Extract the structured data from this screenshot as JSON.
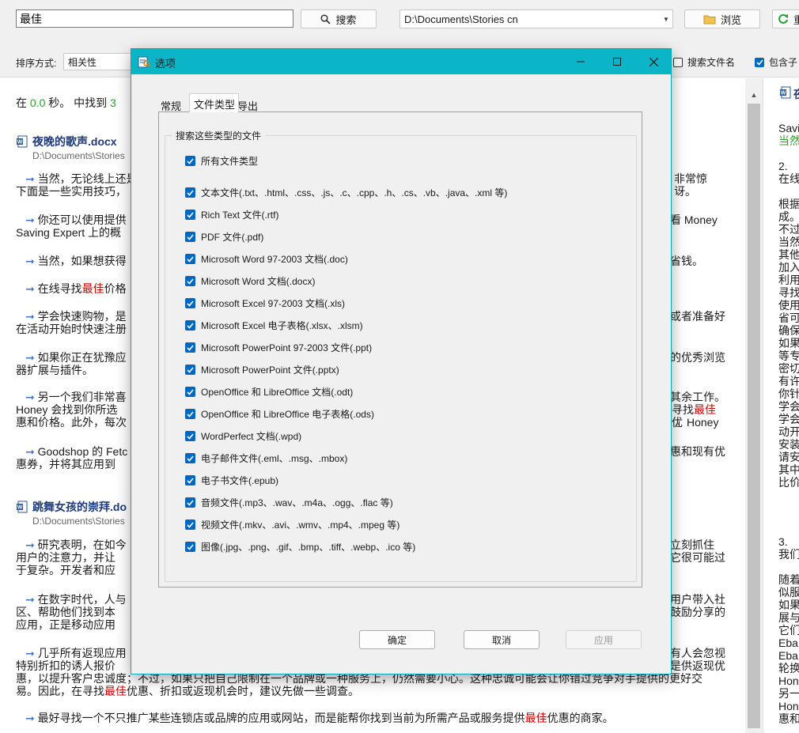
{
  "toolbar": {
    "search_value": "最佳",
    "search_button": "搜索",
    "path": "D:\\Documents\\Stories cn",
    "browse_button": "浏览",
    "refresh_button": "重"
  },
  "sortbar": {
    "label": "排序方式:",
    "sort_value": "相关性",
    "search_filenames": "搜索文件名",
    "include_sub": "包含子"
  },
  "results": {
    "status_prefix": "在",
    "time": "0.0",
    "status_mid": "秒。 中找到",
    "count": "3",
    "doc1": {
      "title": "夜晚的歌声.docx",
      "path": "D:\\Documents\\Stories",
      "p1a": "当然，无论线上还是",
      "p1b": "非常惊讶。",
      "p1c": "下面是一些实用技巧，",
      "p2a": "你还可以使用提供",
      "p2b": "看 Money",
      "p2c": "Saving Expert 上的概",
      "p3a": "当然，如果想获得",
      "p3b": "省钱。",
      "p4a": "在线寻找",
      "p4b": "最佳",
      "p4c": "价格",
      "p5a": "学会快速购物，是",
      "p5b": "或者准备好",
      "p5c": "在活动开始时快速注册",
      "p6a": "如果你正在犹豫应",
      "p6b": "的优秀浏览",
      "p6c": "器扩展与插件。",
      "p7a": "另一个我们非常喜",
      "p7b": "其余工作。",
      "p7c": "Honey 会找到你所选",
      "p7d": "寻找",
      "p7e": "最佳",
      "p7f": "优",
      "p7g": "惠和价格。此外，每次",
      "p7h": "。Honey",
      "p8a": "Goodshop 的 Fetc",
      "p8b": "惠和现有优",
      "p8c": "惠券，并将其应用到"
    },
    "doc2": {
      "title": "跳舞女孩的崇拜.do",
      "path": "D:\\Documents\\Stories",
      "p1a": "研究表明，在如今",
      "p1b": "立刻抓住",
      "p1c": "用户的注意力，并让",
      "p1d": "它很可能过",
      "p1e": "于复杂。开发者和应",
      "p2a": "在数字时代，人与",
      "p2b": "用户带入社",
      "p2c": "区、帮助他们找到本",
      "p2d": "鼓励分享的",
      "p2e": "应用，正是移动应用",
      "p3a": "几乎所有返现应用",
      "p3b": "有人会忽视",
      "p3c": "特别折扣的诱人报价",
      "p3d": "是供返现优",
      "p3e": "惠，以提升客户忠诚度；不过，如果只把自己限制在一个品牌或一种服务上，仍然需要小心。这种忠诚可能会让你错过竞争对手提供的更好交",
      "p3f": "易。因此，在寻找",
      "p3g": "最佳",
      "p3h": "优惠、折扣或返现机会时，建议先做一些调查。",
      "p4a": "最好寻找一个不只推广某些连锁店或品牌的应用或网站，而是能帮你找到当前为所需产品或服务提供",
      "p4b": "最佳",
      "p4c": "优惠的商家。"
    }
  },
  "preview": {
    "title": "夜",
    "lines": [
      "Savi",
      "当然",
      "2.",
      "在线",
      "根据",
      "成。",
      "不过",
      "当然",
      "其他",
      "加入",
      "利用",
      "寻找",
      "使用",
      "省可",
      "确保",
      "如果",
      "等专",
      "密切",
      "有许",
      "你针",
      "学会",
      "学会",
      "动开",
      "安装",
      "请安",
      "其中",
      "比价",
      "3.",
      "我们",
      "随着",
      "似服",
      "如果",
      "展与",
      "它们",
      "Eba",
      "Eba",
      "轮换",
      "Hon",
      "另一",
      "Hon",
      "惠和"
    ]
  },
  "dialog": {
    "title": "选项",
    "tabs": [
      "常规",
      "文件类型",
      "导出"
    ],
    "group_label": "搜索这些类型的文件",
    "all_types": "所有文件类型",
    "options": [
      "文本文件(.txt、.html、.css、.js、.c、.cpp、.h、.cs、.vb、.java、.xml 等)",
      "Rich Text 文件(.rtf)",
      "PDF 文件(.pdf)",
      "Microsoft Word 97-2003 文档(.doc)",
      "Microsoft Word 文档(.docx)",
      "Microsoft Excel 97-2003 文档(.xls)",
      "Microsoft Excel 电子表格(.xlsx、.xlsm)",
      "Microsoft PowerPoint 97-2003 文件(.ppt)",
      "Microsoft PowerPoint 文件(.pptx)",
      "OpenOffice 和 LibreOffice 文档(.odt)",
      "OpenOffice 和 LibreOffice 电子表格(.ods)",
      "WordPerfect 文档(.wpd)",
      "电子邮件文件(.eml、.msg、.mbox)",
      "电子书文件(.epub)",
      "音频文件(.mp3、.wav、.m4a、.ogg、.flac 等)",
      "视频文件(.mkv、.avi、.wmv、.mp4、.mpeg 等)",
      "图像(.jpg、.png、.gif、.bmp、.tiff、.webp、.ico 等)"
    ],
    "ok": "确定",
    "cancel": "取消",
    "apply": "应用"
  },
  "colors": {
    "accent": "#0067c0",
    "titlebar": "#0bb4c6",
    "highlight": "#d20000",
    "number": "#2e9e2e",
    "doc_title": "#1e3a78"
  }
}
